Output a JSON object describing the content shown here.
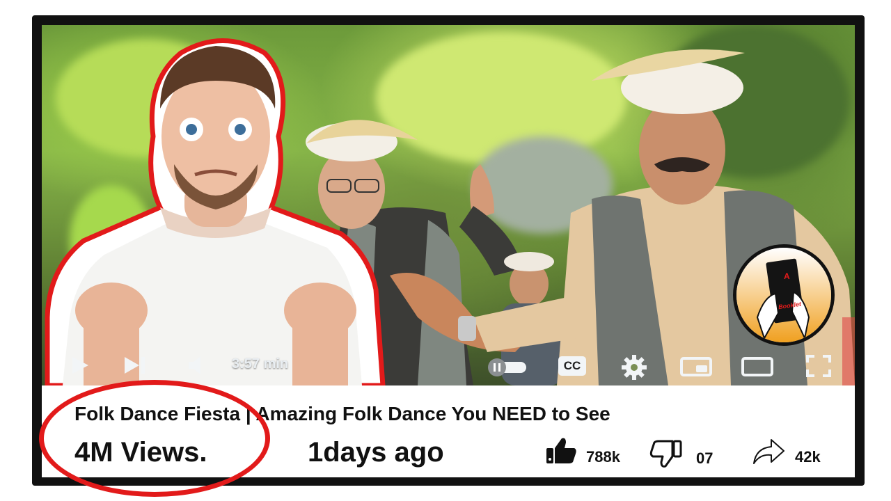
{
  "player": {
    "duration_label": "3:57 min",
    "subtitles_label": "CC"
  },
  "video": {
    "title": "Folk Dance Fiesta | Amazing Folk Dance You NEED to See",
    "views": "4M Views.",
    "uploaded": "1days ago",
    "likes": "788k",
    "dislikes": "07",
    "shares": "42k"
  },
  "channel_logo": {
    "letter": "A",
    "word": "Booklet"
  },
  "colors": {
    "accent_red": "#e21a1a",
    "frame": "#111111",
    "logo_gradient_top": "#ffffff",
    "logo_gradient_bottom": "#f0a020"
  },
  "icons": [
    "play-icon",
    "next-icon",
    "volume-icon",
    "autoplay-toggle-icon",
    "cc-icon",
    "gear-icon",
    "miniplayer-icon",
    "theater-icon",
    "fullscreen-icon",
    "thumbs-up-icon",
    "thumbs-down-icon",
    "share-icon"
  ]
}
